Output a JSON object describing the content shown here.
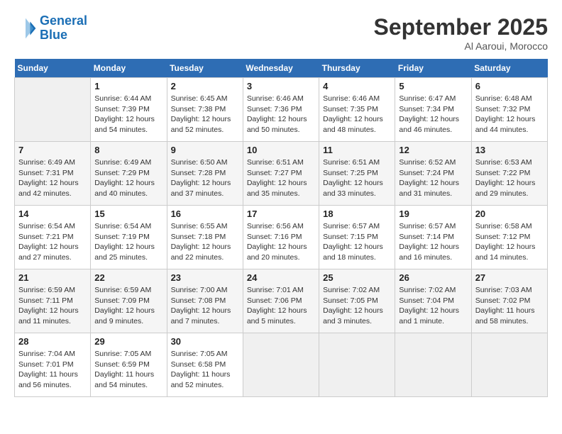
{
  "header": {
    "logo_line1": "General",
    "logo_line2": "Blue",
    "month": "September 2025",
    "location": "Al Aaroui, Morocco"
  },
  "days_of_week": [
    "Sunday",
    "Monday",
    "Tuesday",
    "Wednesday",
    "Thursday",
    "Friday",
    "Saturday"
  ],
  "weeks": [
    [
      {
        "num": "",
        "info": ""
      },
      {
        "num": "1",
        "info": "Sunrise: 6:44 AM\nSunset: 7:39 PM\nDaylight: 12 hours\nand 54 minutes."
      },
      {
        "num": "2",
        "info": "Sunrise: 6:45 AM\nSunset: 7:38 PM\nDaylight: 12 hours\nand 52 minutes."
      },
      {
        "num": "3",
        "info": "Sunrise: 6:46 AM\nSunset: 7:36 PM\nDaylight: 12 hours\nand 50 minutes."
      },
      {
        "num": "4",
        "info": "Sunrise: 6:46 AM\nSunset: 7:35 PM\nDaylight: 12 hours\nand 48 minutes."
      },
      {
        "num": "5",
        "info": "Sunrise: 6:47 AM\nSunset: 7:34 PM\nDaylight: 12 hours\nand 46 minutes."
      },
      {
        "num": "6",
        "info": "Sunrise: 6:48 AM\nSunset: 7:32 PM\nDaylight: 12 hours\nand 44 minutes."
      }
    ],
    [
      {
        "num": "7",
        "info": "Sunrise: 6:49 AM\nSunset: 7:31 PM\nDaylight: 12 hours\nand 42 minutes."
      },
      {
        "num": "8",
        "info": "Sunrise: 6:49 AM\nSunset: 7:29 PM\nDaylight: 12 hours\nand 40 minutes."
      },
      {
        "num": "9",
        "info": "Sunrise: 6:50 AM\nSunset: 7:28 PM\nDaylight: 12 hours\nand 37 minutes."
      },
      {
        "num": "10",
        "info": "Sunrise: 6:51 AM\nSunset: 7:27 PM\nDaylight: 12 hours\nand 35 minutes."
      },
      {
        "num": "11",
        "info": "Sunrise: 6:51 AM\nSunset: 7:25 PM\nDaylight: 12 hours\nand 33 minutes."
      },
      {
        "num": "12",
        "info": "Sunrise: 6:52 AM\nSunset: 7:24 PM\nDaylight: 12 hours\nand 31 minutes."
      },
      {
        "num": "13",
        "info": "Sunrise: 6:53 AM\nSunset: 7:22 PM\nDaylight: 12 hours\nand 29 minutes."
      }
    ],
    [
      {
        "num": "14",
        "info": "Sunrise: 6:54 AM\nSunset: 7:21 PM\nDaylight: 12 hours\nand 27 minutes."
      },
      {
        "num": "15",
        "info": "Sunrise: 6:54 AM\nSunset: 7:19 PM\nDaylight: 12 hours\nand 25 minutes."
      },
      {
        "num": "16",
        "info": "Sunrise: 6:55 AM\nSunset: 7:18 PM\nDaylight: 12 hours\nand 22 minutes."
      },
      {
        "num": "17",
        "info": "Sunrise: 6:56 AM\nSunset: 7:16 PM\nDaylight: 12 hours\nand 20 minutes."
      },
      {
        "num": "18",
        "info": "Sunrise: 6:57 AM\nSunset: 7:15 PM\nDaylight: 12 hours\nand 18 minutes."
      },
      {
        "num": "19",
        "info": "Sunrise: 6:57 AM\nSunset: 7:14 PM\nDaylight: 12 hours\nand 16 minutes."
      },
      {
        "num": "20",
        "info": "Sunrise: 6:58 AM\nSunset: 7:12 PM\nDaylight: 12 hours\nand 14 minutes."
      }
    ],
    [
      {
        "num": "21",
        "info": "Sunrise: 6:59 AM\nSunset: 7:11 PM\nDaylight: 12 hours\nand 11 minutes."
      },
      {
        "num": "22",
        "info": "Sunrise: 6:59 AM\nSunset: 7:09 PM\nDaylight: 12 hours\nand 9 minutes."
      },
      {
        "num": "23",
        "info": "Sunrise: 7:00 AM\nSunset: 7:08 PM\nDaylight: 12 hours\nand 7 minutes."
      },
      {
        "num": "24",
        "info": "Sunrise: 7:01 AM\nSunset: 7:06 PM\nDaylight: 12 hours\nand 5 minutes."
      },
      {
        "num": "25",
        "info": "Sunrise: 7:02 AM\nSunset: 7:05 PM\nDaylight: 12 hours\nand 3 minutes."
      },
      {
        "num": "26",
        "info": "Sunrise: 7:02 AM\nSunset: 7:04 PM\nDaylight: 12 hours\nand 1 minute."
      },
      {
        "num": "27",
        "info": "Sunrise: 7:03 AM\nSunset: 7:02 PM\nDaylight: 11 hours\nand 58 minutes."
      }
    ],
    [
      {
        "num": "28",
        "info": "Sunrise: 7:04 AM\nSunset: 7:01 PM\nDaylight: 11 hours\nand 56 minutes."
      },
      {
        "num": "29",
        "info": "Sunrise: 7:05 AM\nSunset: 6:59 PM\nDaylight: 11 hours\nand 54 minutes."
      },
      {
        "num": "30",
        "info": "Sunrise: 7:05 AM\nSunset: 6:58 PM\nDaylight: 11 hours\nand 52 minutes."
      },
      {
        "num": "",
        "info": ""
      },
      {
        "num": "",
        "info": ""
      },
      {
        "num": "",
        "info": ""
      },
      {
        "num": "",
        "info": ""
      }
    ]
  ]
}
